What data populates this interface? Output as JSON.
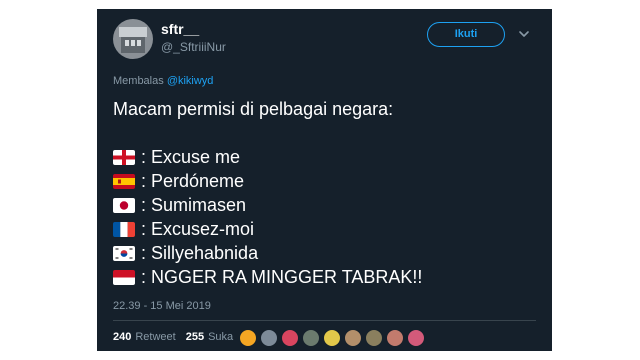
{
  "header": {
    "display_name": "sftr__",
    "handle": "@_SftriiiNur",
    "follow_label": "Ikuti",
    "chevron_icon": "chevron-down-icon"
  },
  "reply": {
    "prefix": "Membalas",
    "mention": "@kikiwyd"
  },
  "tweet": {
    "intro": "Macam permisi di pelbagai negara:",
    "items": [
      {
        "flag": "england-flag-icon",
        "text": ": Excuse me"
      },
      {
        "flag": "spain-flag-icon",
        "text": ": Perdóneme"
      },
      {
        "flag": "japan-flag-icon",
        "text": ": Sumimasen"
      },
      {
        "flag": "france-flag-icon",
        "text": ": Excusez-moi"
      },
      {
        "flag": "korea-flag-icon",
        "text": ": Sillyehabnida"
      },
      {
        "flag": "indonesia-flag-icon",
        "text": ": NGGER RA MINGGER TABRAK!!"
      }
    ]
  },
  "timestamp": "22.39 - 15 Mei 2019",
  "stats": {
    "retweet_count": "240",
    "retweet_label": "Retweet",
    "like_count": "255",
    "like_label": "Suka"
  },
  "likers": {
    "colors": [
      "#f5a623",
      "#7d8b99",
      "#d9455f",
      "#6b7b6e",
      "#e2c84a",
      "#b38f6a",
      "#8a7f5e",
      "#c27b6d",
      "#d35a7a"
    ]
  },
  "colors": {
    "background": "#15202b",
    "accent": "#1da1f2",
    "muted": "#8899a6"
  }
}
